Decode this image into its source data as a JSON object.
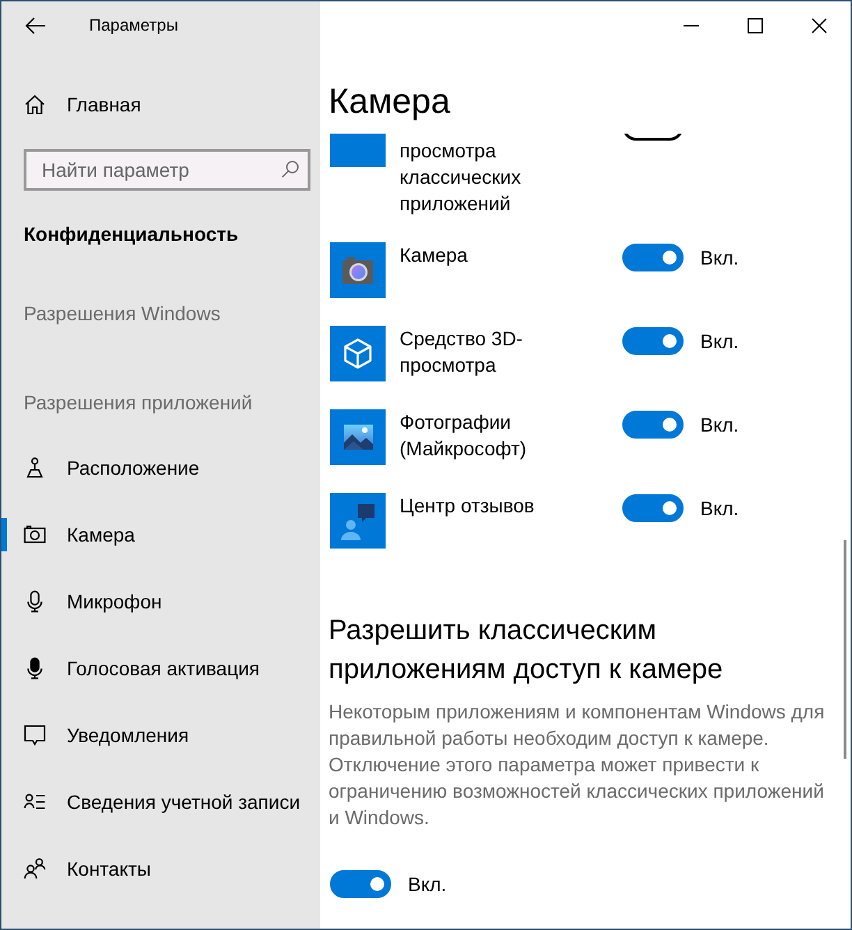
{
  "window": {
    "title": "Параметры"
  },
  "sidebar": {
    "home": {
      "label": "Главная"
    },
    "search": {
      "placeholder": "Найти параметр"
    },
    "section_title": "Конфиденциальность",
    "group_headings": [
      "Разрешения Windows",
      "Разрешения приложений"
    ],
    "items": [
      {
        "label": "Расположение",
        "selected": false
      },
      {
        "label": "Камера",
        "selected": true
      },
      {
        "label": "Микрофон",
        "selected": false
      },
      {
        "label": "Голосовая активация",
        "selected": false
      },
      {
        "label": "Уведомления",
        "selected": false
      },
      {
        "label": "Сведения учетной записи",
        "selected": false
      },
      {
        "label": "Контакты",
        "selected": false
      }
    ]
  },
  "content": {
    "title": "Камера",
    "apps": [
      {
        "name": "просмотра классических приложений",
        "partial": true,
        "on": false
      },
      {
        "name": "Камера",
        "partial": false,
        "on": true,
        "state": "Вкл."
      },
      {
        "name": "Средство 3D-просмотра",
        "partial": false,
        "on": true,
        "state": "Вкл."
      },
      {
        "name": "Фотографии (Майкрософт)",
        "partial": false,
        "on": true,
        "state": "Вкл."
      },
      {
        "name": "Центр отзывов",
        "partial": false,
        "on": true,
        "state": "Вкл."
      }
    ],
    "desktop_apps": {
      "heading": "Разрешить классическим приложениям доступ к камере",
      "description": "Некоторым приложениям и компонентам Windows для правильной работы необходим доступ к камере. Отключение этого параметра может привести к ограничению возможностей классических приложений и Windows.",
      "on": true,
      "state": "Вкл."
    }
  }
}
